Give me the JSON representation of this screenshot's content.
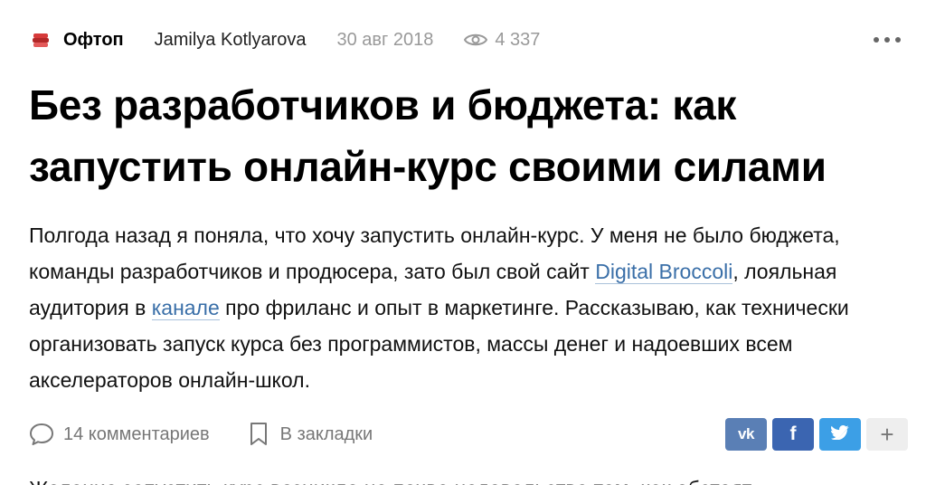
{
  "meta": {
    "subsite": "Офтоп",
    "author": "Jamilya Kotlyarova",
    "date": "30 авг 2018",
    "views": "4 337"
  },
  "title": "Без разработчиков и бюджета: как запустить онлайн-курс своими силами",
  "lead": {
    "part1": "Полгода назад я поняла, что хочу запустить онлайн-курс. У меня не было бюджета, команды разработчиков и продюсера, зато был свой сайт ",
    "link1": "Digital Broccoli",
    "part2": ", лояльная аудитория в ",
    "link2": "канале",
    "part3": " про фриланс и опыт в маркетинге. Рассказываю, как технически организовать запуск курса без программистов, массы денег и надоевших всем акселераторов онлайн-школ."
  },
  "actions": {
    "comments": "14 комментариев",
    "bookmark": "В закладки",
    "share_vk": "vk",
    "share_fb": "f",
    "share_plus": "+"
  },
  "next_paragraph": "Желание запустить курс возникло не почве недовольства тем, как обстоят",
  "colors": {
    "link": "#3a6fa8",
    "vk": "#5a7fb5",
    "facebook": "#3b65b1",
    "twitter": "#3c9fe6"
  }
}
